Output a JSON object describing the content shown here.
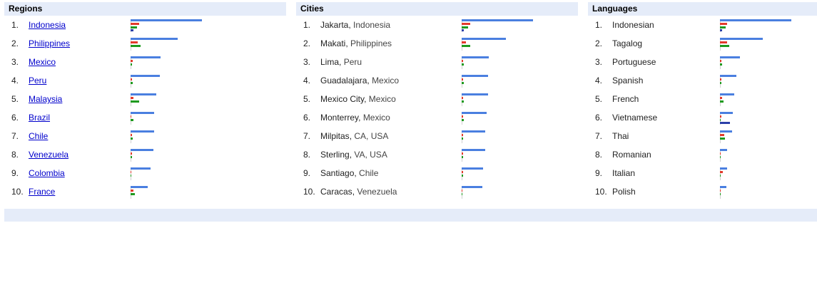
{
  "colors": {
    "header_bg": "#e5ecf9",
    "bar_blue": "#4a7fe0",
    "bar_red": "#e33a2b",
    "bar_green": "#1f9a1f",
    "bar_navy": "#2b3fa8",
    "link": "#0000cc"
  },
  "regions": {
    "title": "Regions",
    "items": [
      {
        "rank": "1.",
        "name": "Indonesia",
        "blue": 100,
        "red": 12,
        "green": 9,
        "navy": 4
      },
      {
        "rank": "2.",
        "name": "Philippines",
        "blue": 66,
        "red": 10,
        "green": 14,
        "navy": 0
      },
      {
        "rank": "3.",
        "name": "Mexico",
        "blue": 42,
        "red": 3,
        "green": 2,
        "navy": 0
      },
      {
        "rank": "4.",
        "name": "Peru",
        "blue": 41,
        "red": 2,
        "green": 3,
        "navy": 0
      },
      {
        "rank": "5.",
        "name": "Malaysia",
        "blue": 36,
        "red": 4,
        "green": 12,
        "navy": 0
      },
      {
        "rank": "6.",
        "name": "Brazil",
        "blue": 33,
        "red": 1,
        "green": 4,
        "navy": 0
      },
      {
        "rank": "7.",
        "name": "Chile",
        "blue": 33,
        "red": 2,
        "green": 3,
        "navy": 0
      },
      {
        "rank": "8.",
        "name": "Venezuela",
        "blue": 32,
        "red": 2,
        "green": 2,
        "navy": 0
      },
      {
        "rank": "9.",
        "name": "Colombia",
        "blue": 28,
        "red": 1,
        "green": 1,
        "navy": 0
      },
      {
        "rank": "10.",
        "name": "France",
        "blue": 24,
        "red": 4,
        "green": 6,
        "navy": 0
      }
    ]
  },
  "cities": {
    "title": "Cities",
    "items": [
      {
        "rank": "1.",
        "city": "Jakarta",
        "where": "Indonesia",
        "blue": 100,
        "red": 12,
        "green": 9,
        "navy": 3
      },
      {
        "rank": "2.",
        "city": "Makati",
        "where": "Philippines",
        "blue": 62,
        "red": 6,
        "green": 12,
        "navy": 0
      },
      {
        "rank": "3.",
        "city": "Lima",
        "where": "Peru",
        "blue": 38,
        "red": 2,
        "green": 3,
        "navy": 0
      },
      {
        "rank": "4.",
        "city": "Guadalajara",
        "where": "Mexico",
        "blue": 37,
        "red": 2,
        "green": 3,
        "navy": 0
      },
      {
        "rank": "5.",
        "city": "Mexico City",
        "where": "Mexico",
        "blue": 37,
        "red": 2,
        "green": 3,
        "navy": 0
      },
      {
        "rank": "6.",
        "city": "Monterrey",
        "where": "Mexico",
        "blue": 35,
        "red": 2,
        "green": 3,
        "navy": 0
      },
      {
        "rank": "7.",
        "city": "Milpitas",
        "where": "CA, USA",
        "blue": 33,
        "red": 2,
        "green": 2,
        "navy": 0
      },
      {
        "rank": "8.",
        "city": "Sterling",
        "where": "VA, USA",
        "blue": 33,
        "red": 2,
        "green": 2,
        "navy": 0
      },
      {
        "rank": "9.",
        "city": "Santiago",
        "where": "Chile",
        "blue": 30,
        "red": 2,
        "green": 2,
        "navy": 0
      },
      {
        "rank": "10.",
        "city": "Caracas",
        "where": "Venezuela",
        "blue": 29,
        "red": 1,
        "green": 1,
        "navy": 0
      }
    ]
  },
  "languages": {
    "title": "Languages",
    "items": [
      {
        "rank": "1.",
        "name": "Indonesian",
        "blue": 100,
        "red": 10,
        "green": 8,
        "navy": 3
      },
      {
        "rank": "2.",
        "name": "Tagalog",
        "blue": 60,
        "red": 10,
        "green": 13,
        "navy": 0
      },
      {
        "rank": "3.",
        "name": "Portuguese",
        "blue": 28,
        "red": 2,
        "green": 3,
        "navy": 0
      },
      {
        "rank": "4.",
        "name": "Spanish",
        "blue": 23,
        "red": 2,
        "green": 2,
        "navy": 0
      },
      {
        "rank": "5.",
        "name": "French",
        "blue": 20,
        "red": 3,
        "green": 5,
        "navy": 0
      },
      {
        "rank": "6.",
        "name": "Vietnamese",
        "blue": 18,
        "red": 2,
        "green": 1,
        "navy": 14
      },
      {
        "rank": "7.",
        "name": "Thai",
        "blue": 17,
        "red": 6,
        "green": 7,
        "navy": 0
      },
      {
        "rank": "8.",
        "name": "Romanian",
        "blue": 10,
        "red": 1,
        "green": 1,
        "navy": 0
      },
      {
        "rank": "9.",
        "name": "Italian",
        "blue": 10,
        "red": 4,
        "green": 1,
        "navy": 0
      },
      {
        "rank": "10.",
        "name": "Polish",
        "blue": 9,
        "red": 1,
        "green": 1,
        "navy": 0
      }
    ]
  }
}
